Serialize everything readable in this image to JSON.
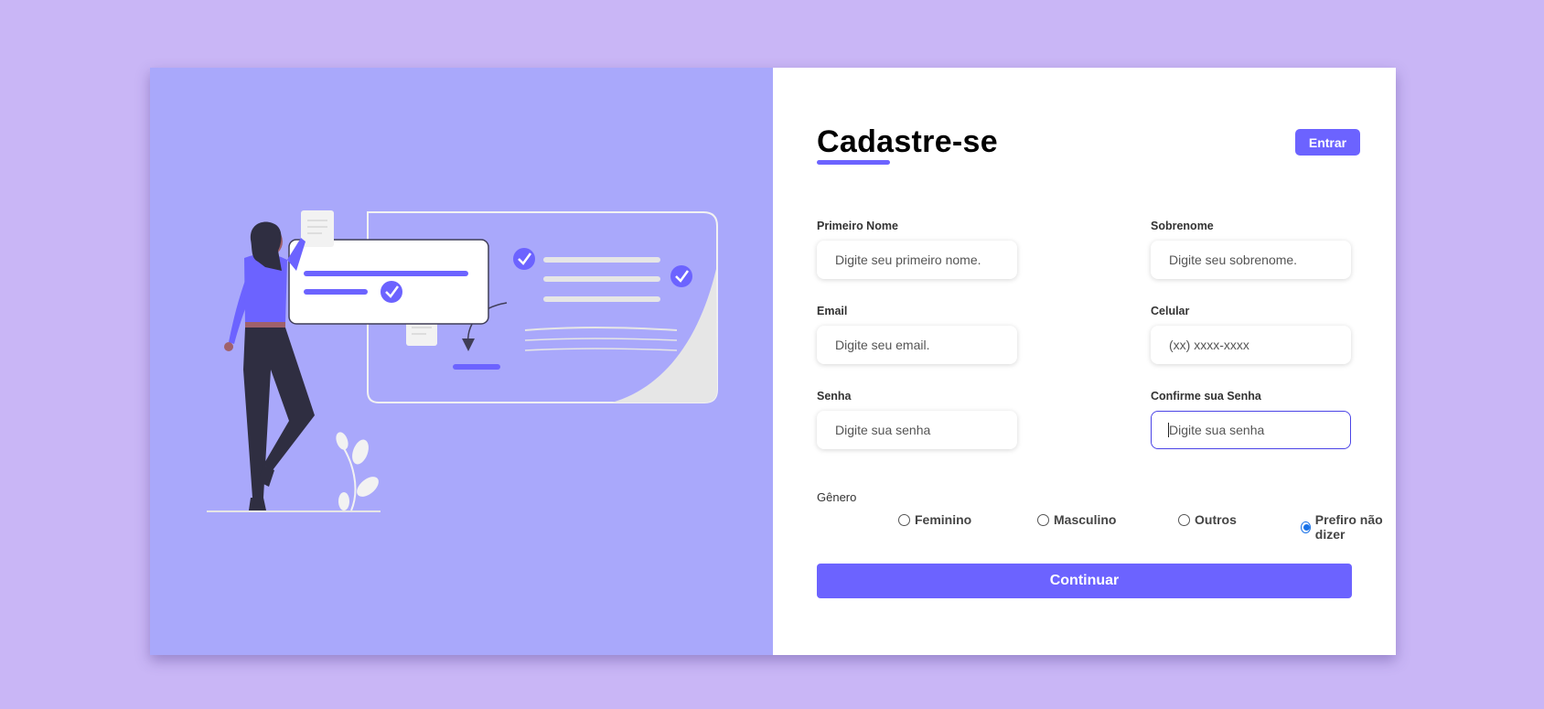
{
  "header": {
    "title": "Cadastre-se",
    "login_label": "Entrar"
  },
  "form": {
    "first_name": {
      "label": "Primeiro Nome",
      "placeholder": "Digite seu primeiro nome.",
      "value": ""
    },
    "last_name": {
      "label": "Sobrenome",
      "placeholder": "Digite seu sobrenome.",
      "value": ""
    },
    "email": {
      "label": "Email",
      "placeholder": "Digite seu email.",
      "value": ""
    },
    "phone": {
      "label": "Celular",
      "placeholder": "(xx) xxxx-xxxx",
      "value": ""
    },
    "password": {
      "label": "Senha",
      "placeholder": "Digite sua senha",
      "value": ""
    },
    "confirm_password": {
      "label": "Confirme sua Senha",
      "placeholder": "Digite sua senha",
      "value": ""
    }
  },
  "gender": {
    "label": "Gênero",
    "options": [
      "Feminino",
      "Masculino",
      "Outros",
      "Prefiro não dizer"
    ],
    "selected": "Prefiro não dizer"
  },
  "submit_label": "Continuar",
  "colors": {
    "page_bg": "#c9b6f6",
    "illustration_bg": "#a9a8fb",
    "accent": "#6c63ff",
    "focus_border": "#4b44e6",
    "radio_checked": "#1a73e8"
  },
  "icons": {
    "illustration": "woman-with-checklist-illustration",
    "check": "check-circle-icon"
  }
}
